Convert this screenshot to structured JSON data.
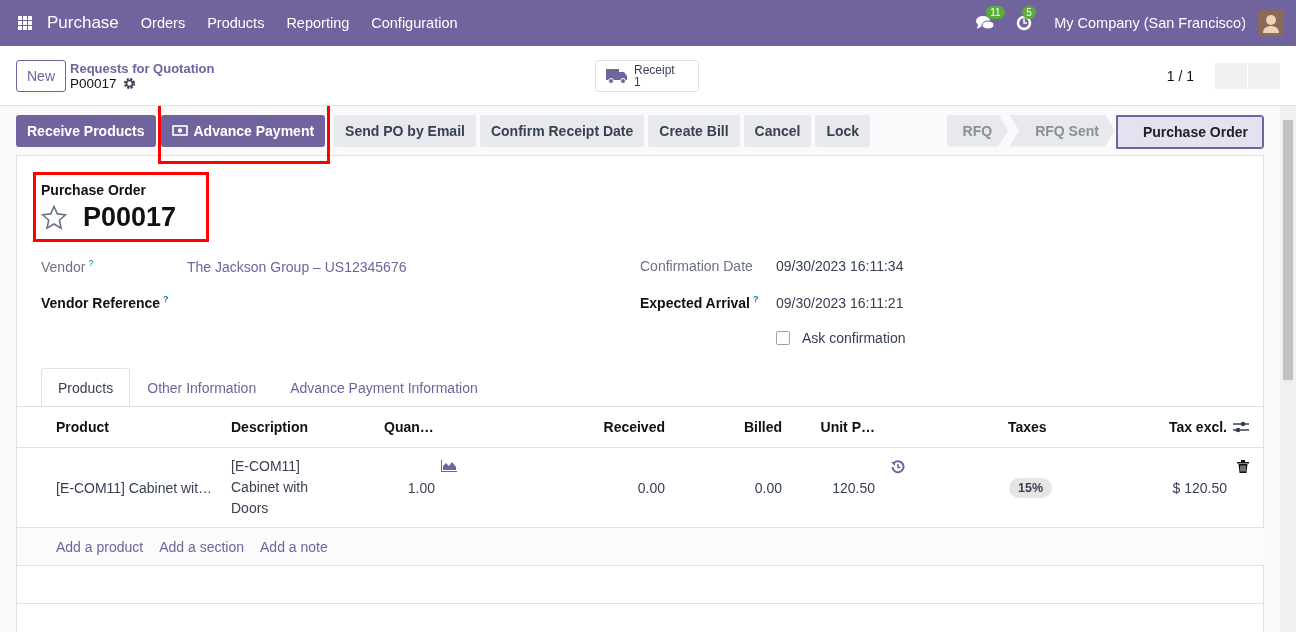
{
  "navbar": {
    "app_name": "Purchase",
    "menu": [
      "Orders",
      "Products",
      "Reporting",
      "Configuration"
    ],
    "messages_badge": "11",
    "activities_badge": "5",
    "company": "My Company (San Francisco)"
  },
  "control_panel": {
    "new_button": "New",
    "breadcrumb": "Requests for Quotation",
    "record": "P00017",
    "smart_button": {
      "label": "Receipt",
      "count": "1"
    },
    "pager": "1 / 1"
  },
  "actions": [
    {
      "label": "Receive Products",
      "kind": "primary",
      "icon": false,
      "highlighted": false
    },
    {
      "label": "Advance Payment",
      "kind": "primary",
      "icon": true,
      "highlighted": true
    },
    {
      "label": "Send PO by Email",
      "kind": "secondary",
      "icon": false,
      "highlighted": false
    },
    {
      "label": "Confirm Receipt Date",
      "kind": "secondary",
      "icon": false,
      "highlighted": false
    },
    {
      "label": "Create Bill",
      "kind": "secondary",
      "icon": false,
      "highlighted": false
    },
    {
      "label": "Cancel",
      "kind": "secondary",
      "icon": false,
      "highlighted": false
    },
    {
      "label": "Lock",
      "kind": "secondary",
      "icon": false,
      "highlighted": false
    }
  ],
  "status": [
    {
      "label": "RFQ",
      "selected": false
    },
    {
      "label": "RFQ Sent",
      "selected": false
    },
    {
      "label": "Purchase Order",
      "selected": true
    }
  ],
  "form": {
    "title_label": "Purchase Order",
    "name": "P00017",
    "starred": false,
    "title_highlighted": true,
    "left_fields": [
      {
        "label": "Vendor",
        "bold": false,
        "help": "?",
        "value": "The Jackson Group – US12345676"
      },
      {
        "label": "Vendor Reference",
        "bold": true,
        "help": "?"
      }
    ],
    "right_fields": [
      {
        "label": "Confirmation Date",
        "bold": false,
        "value": "09/30/2023 16:11:34"
      },
      {
        "label": "Expected Arrival",
        "bold": true,
        "help": "?",
        "value": "09/30/2023 16:11:21"
      }
    ],
    "ask_confirmation": {
      "label": "Ask confirmation",
      "checked": false
    }
  },
  "tabs": [
    {
      "label": "Products",
      "selected": true
    },
    {
      "label": "Other Information",
      "selected": false
    },
    {
      "label": "Advance Payment Information",
      "selected": false
    }
  ],
  "table": {
    "columns": [
      "Product",
      "Description",
      "Quan…",
      "Received",
      "Billed",
      "Unit P…",
      "Taxes",
      "Tax excl."
    ],
    "rows": [
      {
        "product": "[E-COM11] Cabinet wit…",
        "description": "[E-COM11] Cabinet with Doors",
        "quantity": "1.00",
        "received": "0.00",
        "billed": "0.00",
        "unit_price": "120.50",
        "taxes": "15%",
        "subtotal": "$ 120.50"
      }
    ],
    "add_links": [
      "Add a product",
      "Add a section",
      "Add a note"
    ]
  }
}
